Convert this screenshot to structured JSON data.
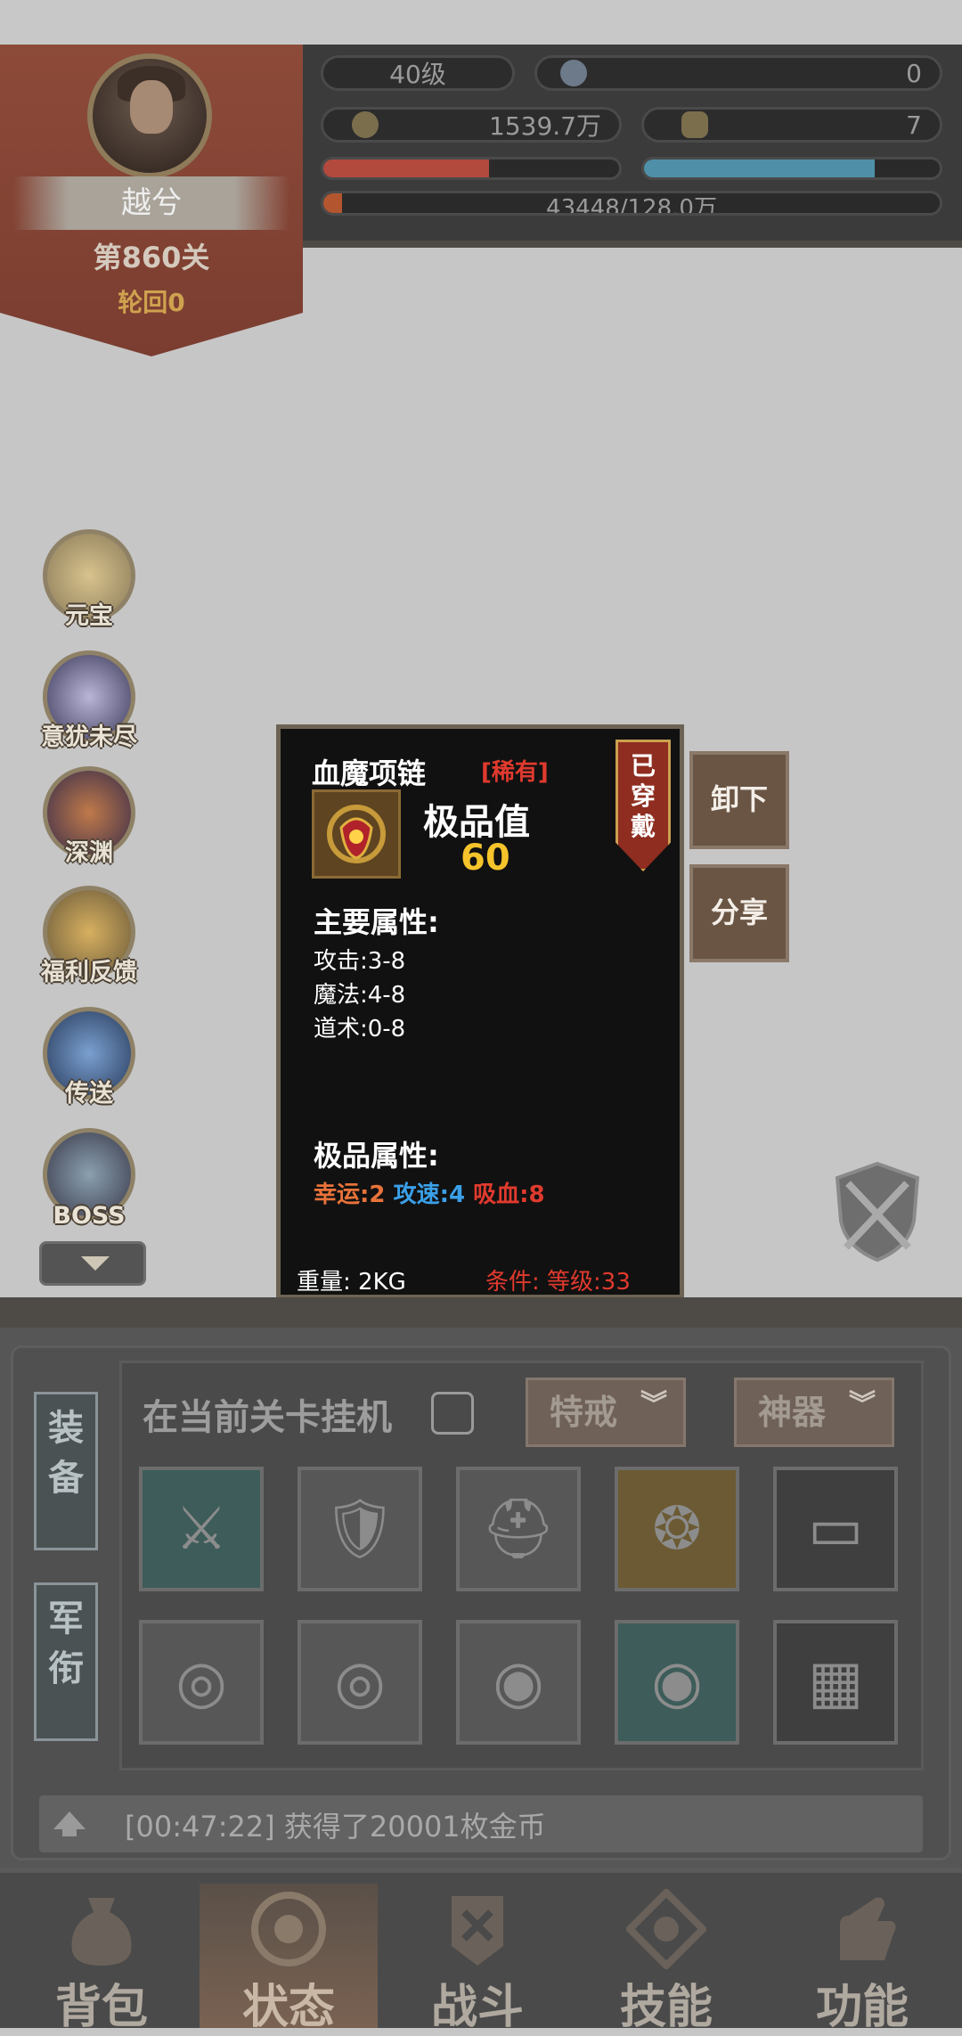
{
  "player": {
    "level": "40级",
    "diamond": "0",
    "gold": "1539.7万",
    "ingot": "7",
    "name": "越兮",
    "stage": "第860关",
    "cycle": "轮回0",
    "exp": "43448/128.0万",
    "hp_fraction": 0.56,
    "mp_fraction": 0.78,
    "exp_fraction": 0.03
  },
  "side_menu": [
    "元宝",
    "意犹未尽",
    "深渊",
    "福利反馈",
    "传送",
    "BOSS"
  ],
  "tooltip": {
    "name": "血魔项链",
    "rarity": "[稀有]",
    "worn_label": "已穿戴",
    "quality_label": "极品值",
    "quality_value": "60",
    "main_attr_title": "主要属性:",
    "main_attrs": [
      "攻击:3-8",
      "魔法:4-8",
      "道术:0-8"
    ],
    "extra_attr_title": "极品属性:",
    "extra_attrs": [
      {
        "text": "幸运:2",
        "color": "#e8733a"
      },
      {
        "text": "攻速:4",
        "color": "#3aa0e8"
      },
      {
        "text": "吸血:8",
        "color": "#e03a2e"
      }
    ],
    "weight": "重量: 2KG",
    "condition": "条件: 等级:33"
  },
  "actions": {
    "unequip": "卸下",
    "share": "分享"
  },
  "equip_panel": {
    "tab_equip": "装备",
    "tab_rank": "军衔",
    "hang_label": "在当前关卡挂机",
    "special_ring": "特戒",
    "artifact": "神器",
    "slots": [
      {
        "name": "weapon",
        "bg": "#3d5c5a"
      },
      {
        "name": "armor",
        "bg": "#575757"
      },
      {
        "name": "helmet",
        "bg": "#575757"
      },
      {
        "name": "necklace",
        "bg": "#6b5a33"
      },
      {
        "name": "belt",
        "bg": "#3f3f3f"
      },
      {
        "name": "ring-left",
        "bg": "#575757"
      },
      {
        "name": "ring-right",
        "bg": "#575757"
      },
      {
        "name": "bracelet-left",
        "bg": "#575757"
      },
      {
        "name": "bracelet-right",
        "bg": "#3d5c5a"
      },
      {
        "name": "boots",
        "bg": "#3f3f3f"
      }
    ]
  },
  "log": "[00:47:22] 获得了20001枚金币",
  "nav": [
    "背包",
    "状态",
    "战斗",
    "技能",
    "功能"
  ],
  "colors": {
    "hp": "#b34a3e",
    "mp": "#4f8fa8",
    "exp": "#b3562f",
    "accent": "#caa04f"
  }
}
